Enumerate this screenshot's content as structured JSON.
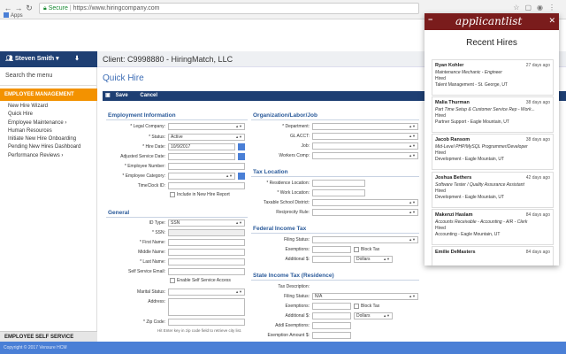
{
  "browser": {
    "secure_label": "Secure",
    "url": "https://www.hiringcompany.com",
    "bookmark_apps": "Apps"
  },
  "sidebar": {
    "user_name": "Steven Smith",
    "search_placeholder": "Search the menu",
    "section_label": "EMPLOYEE MANAGEMENT",
    "items": [
      "New Hire Wizard",
      "Quick Hire",
      "Employee Maintenance",
      "Human Resources",
      "Initiate New Hire Onboarding",
      "Pending New Hires Dashboard",
      "Performance Reviews"
    ],
    "footer_label": "EMPLOYEE SELF SERVICE"
  },
  "header": {
    "client": "Client: C9998880 - HiringMatch, LLC",
    "page_title": "Quick Hire",
    "save_label": "Save",
    "cancel_label": "Cancel"
  },
  "employment": {
    "title": "Employment Information",
    "legal_company": "* Legal Company:",
    "status": "* Status:",
    "status_value": "Active",
    "hire_date": "* Hire Date:",
    "hire_date_value": "10/9/2017",
    "adjusted_service_date": "Adjusted Service Date:",
    "employee_number": "* Employee Number:",
    "employee_category": "* Employee Category:",
    "timeclock_id": "TimeClock ID:",
    "include_report": "Include in New Hire Report"
  },
  "general": {
    "title": "General",
    "id_type": "ID Type:",
    "id_type_value": "SSN",
    "ssn": "* SSN:",
    "first_name": "* First Name:",
    "middle_name": "Middle Name:",
    "last_name": "* Last Name:",
    "ss_email": "Self Service Email:",
    "enable_ss": "Enable Self Service Access",
    "marital_status": "Marital Status:",
    "address": "Address:",
    "zip_code": "* Zip Code:",
    "zip_hint": "Hit Enter key in zip code field to retrieve city list."
  },
  "org": {
    "title": "Organization/Labor/Job",
    "department": "* Department:",
    "gl_acct": "GL ACCT:",
    "job": "Job:",
    "workers_comp": "Workers Comp:"
  },
  "tax_location": {
    "title": "Tax Location",
    "residence": "* Residence Location:",
    "work": "* Work Location:",
    "school_district": "Taxable School District:",
    "reciprocity": "Reciprocity Rule:"
  },
  "federal_tax": {
    "title": "Federal Income Tax",
    "filing_status": "Filing Status:",
    "exemptions": "Exemptions:",
    "block_tax": "Block Tax",
    "additional": "Additional $:",
    "dollars": "Dollars"
  },
  "state_tax": {
    "title": "State Income Tax (Residence)",
    "tax_description": "Tax Description:",
    "filing_status": "Filing Status:",
    "filing_value": "N/A",
    "exemptions": "Exemptions:",
    "block_tax": "Block Tax",
    "additional": "Additional $:",
    "dollars": "Dollars",
    "addl_exemptions": "Addl Exemptions:",
    "exemption_amount": "Exemption Amount $:"
  },
  "footer": {
    "copyright": "Copyright © 2017 Vensure HCM"
  },
  "popup": {
    "logo": "applicantlist",
    "title": "Recent Hires",
    "hires": [
      {
        "name": "Ryan Kohler",
        "ago": "27 days ago",
        "job": "Maintenance Mechanic - Engineer",
        "status": "Hired",
        "location": "Talent Management - St. George, UT"
      },
      {
        "name": "Malia Thurman",
        "ago": "38 days ago",
        "job": "Part Time Setup & Customer Service Rep - Work...",
        "status": "Hired",
        "location": "Partner Support - Eagle Mountain, UT"
      },
      {
        "name": "Jacob Ransom",
        "ago": "38 days ago",
        "job": "Mid-Level PHP/MySQL Programmer/Developer",
        "status": "Hired",
        "location": "Development - Eagle Mountain, UT"
      },
      {
        "name": "Joshua Bethers",
        "ago": "42 days ago",
        "job": "Software Tester / Quality Assurance Assistant",
        "status": "Hired",
        "location": "Development - Eagle Mountain, UT"
      },
      {
        "name": "Makenzi Haslam",
        "ago": "84 days ago",
        "job": "Accounts Receivable - Accounting - A/R - Clerk",
        "status": "Hired",
        "location": "Accounting - Eagle Mountain, UT"
      },
      {
        "name": "Emilie DeMasters",
        "ago": "84 days ago",
        "job": "",
        "status": "",
        "location": ""
      }
    ]
  }
}
